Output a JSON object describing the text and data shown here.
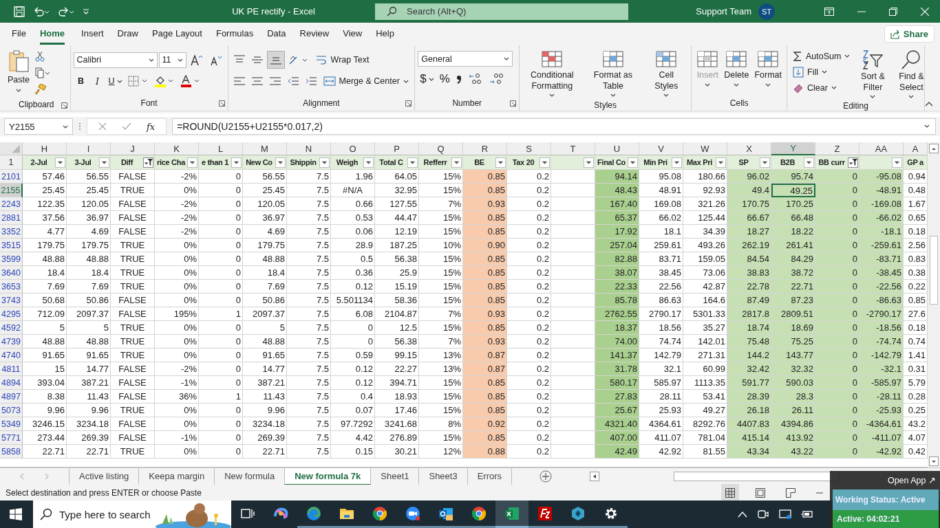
{
  "title_bar": {
    "title": "UK PE rectify  -  Excel",
    "search_placeholder": "Search (Alt+Q)",
    "user": "Support Team",
    "avatar": "ST"
  },
  "menu_tabs": [
    {
      "label": "File",
      "selected": false
    },
    {
      "label": "Home",
      "selected": true
    },
    {
      "label": "Insert",
      "selected": false
    },
    {
      "label": "Draw",
      "selected": false
    },
    {
      "label": "Page Layout",
      "selected": false
    },
    {
      "label": "Formulas",
      "selected": false
    },
    {
      "label": "Data",
      "selected": false
    },
    {
      "label": "Review",
      "selected": false
    },
    {
      "label": "View",
      "selected": false
    },
    {
      "label": "Help",
      "selected": false
    }
  ],
  "share": "Share",
  "ribbon": {
    "groups": [
      {
        "kind": "clipboard",
        "label": "Clipboard",
        "paste": "Paste"
      },
      {
        "kind": "font",
        "label": "Font",
        "font_name": "Calibri",
        "font_size": "11",
        "bold": "B",
        "italic": "I",
        "underline": "U"
      },
      {
        "kind": "alignment",
        "label": "Alignment",
        "wrap": "Wrap Text",
        "merge": "Merge & Center"
      },
      {
        "kind": "number",
        "label": "Number",
        "format": "General",
        "currency": "$",
        "percent": "%"
      },
      {
        "kind": "large",
        "label": "Styles",
        "buttons": [
          {
            "label": "Conditional Formatting",
            "disabled": false
          },
          {
            "label": "Format as Table",
            "disabled": false
          },
          {
            "label": "Cell Styles",
            "disabled": false
          }
        ]
      },
      {
        "kind": "large",
        "label": "Cells",
        "buttons": [
          {
            "label": "Insert",
            "disabled": true
          },
          {
            "label": "Delete",
            "disabled": false
          },
          {
            "label": "Format",
            "disabled": false
          }
        ]
      },
      {
        "kind": "editing",
        "label": "Editing",
        "small": [
          "AutoSum",
          "Fill",
          "Clear"
        ],
        "large": [
          "Sort & Filter",
          "Find & Select"
        ]
      }
    ]
  },
  "formula_bar": {
    "name_box": "Y2155",
    "fx": "fx",
    "formula": "=ROUND(U2155+U2155*0.017,2)"
  },
  "sheet": {
    "columns": [
      {
        "letter": "H",
        "header": "2-Jul",
        "filter_button": true,
        "filtered": false,
        "selected": false,
        "color": "#ffffff"
      },
      {
        "letter": "I",
        "header": "3-Jul",
        "filter_button": true,
        "filtered": false,
        "selected": false,
        "color": "#ffffff"
      },
      {
        "letter": "J",
        "header": "Diff",
        "filter_button": true,
        "filtered": true,
        "selected": false,
        "color": "#ffffff"
      },
      {
        "letter": "K",
        "header": "rice Cha",
        "filter_button": true,
        "filtered": false,
        "selected": false,
        "color": "#ffffff"
      },
      {
        "letter": "L",
        "header": "e than 1",
        "filter_button": true,
        "filtered": false,
        "selected": false,
        "color": "#ffffff"
      },
      {
        "letter": "M",
        "header": "New Co",
        "filter_button": true,
        "filtered": false,
        "selected": false,
        "color": "#ffffff"
      },
      {
        "letter": "N",
        "header": "Shippin",
        "filter_button": true,
        "filtered": false,
        "selected": false,
        "color": "#ffffff"
      },
      {
        "letter": "O",
        "header": "Weigh",
        "filter_button": true,
        "filtered": false,
        "selected": false,
        "color": "#ffffff"
      },
      {
        "letter": "P",
        "header": "Total C",
        "filter_button": true,
        "filtered": false,
        "selected": false,
        "color": "#ffffff"
      },
      {
        "letter": "Q",
        "header": "Refferr",
        "filter_button": true,
        "filtered": false,
        "selected": false,
        "color": "#ffffff"
      },
      {
        "letter": "R",
        "header": "BE",
        "filter_button": true,
        "filtered": false,
        "selected": false,
        "color": "#f8cbad"
      },
      {
        "letter": "S",
        "header": "Tax 20",
        "filter_button": true,
        "filtered": false,
        "selected": false,
        "color": "#ffffff"
      },
      {
        "letter": "T",
        "filter_button": true,
        "filtered": false,
        "selected": false,
        "color": "#ffffff"
      },
      {
        "letter": "U",
        "header": "Final Co",
        "filter_button": true,
        "filtered": false,
        "selected": false,
        "color": "#a9d08e"
      },
      {
        "letter": "V",
        "header": "Min Pri",
        "filter_button": true,
        "filtered": false,
        "selected": false,
        "color": "#ffffff"
      },
      {
        "letter": "W",
        "header": "Max Pri",
        "filter_button": true,
        "filtered": false,
        "selected": false,
        "color": "#ffffff"
      },
      {
        "letter": "X",
        "header": "SP",
        "filter_button": true,
        "filtered": false,
        "selected": false,
        "color": "#c6e0b4"
      },
      {
        "letter": "Y",
        "header": "B2B",
        "filter_button": true,
        "filtered": false,
        "selected": true,
        "color": "#c6e0b4"
      },
      {
        "letter": "Z",
        "header": "BB curr",
        "filter_button": true,
        "filtered": true,
        "selected": false,
        "color": "#c6e0b4"
      },
      {
        "letter": "AA",
        "filter_button": true,
        "filtered": false,
        "selected": false,
        "color": "#c6e0b4"
      },
      {
        "letter": "A",
        "header": "GP a",
        "filter_button": false,
        "selected": false,
        "color": "#ffffff"
      }
    ],
    "header_row": "1",
    "rows": [
      {
        "row": "2101",
        "selected": false,
        "cells": [
          "57.46",
          "56.55",
          "FALSE",
          "-2%",
          "0",
          "56.55",
          "7.5",
          "1.96",
          "64.05",
          "15%",
          "0.85",
          "0.2",
          null,
          "94.14",
          "95.08",
          "180.66",
          "96.02",
          "95.74",
          "0",
          "-95.08",
          "0.94"
        ]
      },
      {
        "row": "2155",
        "selected": true,
        "cells": [
          "25.45",
          "25.45",
          "TRUE",
          "0%",
          "0",
          "25.45",
          "7.5",
          "#N/A",
          "32.95",
          "15%",
          "0.85",
          "0.2",
          null,
          "48.43",
          "48.91",
          "92.93",
          "49.4",
          "49.25",
          "0",
          "-48.91",
          "0.48"
        ]
      },
      {
        "row": "2243",
        "selected": false,
        "cells": [
          "122.35",
          "120.05",
          "FALSE",
          "-2%",
          "0",
          "120.05",
          "7.5",
          "0.66",
          "127.55",
          "7%",
          "0.93",
          "0.2",
          null,
          "167.40",
          "169.08",
          "321.26",
          "170.75",
          "170.25",
          "0",
          "-169.08",
          "1.67"
        ]
      },
      {
        "row": "2881",
        "selected": false,
        "cells": [
          "37.56",
          "36.97",
          "FALSE",
          "-2%",
          "0",
          "36.97",
          "7.5",
          "0.53",
          "44.47",
          "15%",
          "0.85",
          "0.2",
          null,
          "65.37",
          "66.02",
          "125.44",
          "66.67",
          "66.48",
          "0",
          "-66.02",
          "0.65"
        ]
      },
      {
        "row": "3352",
        "selected": false,
        "cells": [
          "4.77",
          "4.69",
          "FALSE",
          "-2%",
          "0",
          "4.69",
          "7.5",
          "0.06",
          "12.19",
          "15%",
          "0.85",
          "0.2",
          null,
          "17.92",
          "18.1",
          "34.39",
          "18.27",
          "18.22",
          "0",
          "-18.1",
          "0.18"
        ]
      },
      {
        "row": "3515",
        "selected": false,
        "cells": [
          "179.75",
          "179.75",
          "TRUE",
          "0%",
          "0",
          "179.75",
          "7.5",
          "28.9",
          "187.25",
          "10%",
          "0.90",
          "0.2",
          null,
          "257.04",
          "259.61",
          "493.26",
          "262.19",
          "261.41",
          "0",
          "-259.61",
          "2.56"
        ]
      },
      {
        "row": "3599",
        "selected": false,
        "cells": [
          "48.88",
          "48.88",
          "TRUE",
          "0%",
          "0",
          "48.88",
          "7.5",
          "0.5",
          "56.38",
          "15%",
          "0.85",
          "0.2",
          null,
          "82.88",
          "83.71",
          "159.05",
          "84.54",
          "84.29",
          "0",
          "-83.71",
          "0.83"
        ]
      },
      {
        "row": "3640",
        "selected": false,
        "cells": [
          "18.4",
          "18.4",
          "TRUE",
          "0%",
          "0",
          "18.4",
          "7.5",
          "0.36",
          "25.9",
          "15%",
          "0.85",
          "0.2",
          null,
          "38.07",
          "38.45",
          "73.06",
          "38.83",
          "38.72",
          "0",
          "-38.45",
          "0.38"
        ]
      },
      {
        "row": "3653",
        "selected": false,
        "cells": [
          "7.69",
          "7.69",
          "TRUE",
          "0%",
          "0",
          "7.69",
          "7.5",
          "0.12",
          "15.19",
          "15%",
          "0.85",
          "0.2",
          null,
          "22.33",
          "22.56",
          "42.87",
          "22.78",
          "22.71",
          "0",
          "-22.56",
          "0.22"
        ]
      },
      {
        "row": "3743",
        "selected": false,
        "cells": [
          "50.68",
          "50.86",
          "FALSE",
          "0%",
          "0",
          "50.86",
          "7.5",
          "5.501134",
          "58.36",
          "15%",
          "0.85",
          "0.2",
          null,
          "85.78",
          "86.63",
          "164.6",
          "87.49",
          "87.23",
          "0",
          "-86.63",
          "0.85"
        ]
      },
      {
        "row": "4295",
        "selected": false,
        "cells": [
          "712.09",
          "2097.37",
          "FALSE",
          "195%",
          "1",
          "2097.37",
          "7.5",
          "6.08",
          "2104.87",
          "7%",
          "0.93",
          "0.2",
          null,
          "2762.55",
          "2790.17",
          "5301.33",
          "2817.8",
          "2809.51",
          "0",
          "-2790.17",
          "27.6"
        ]
      },
      {
        "row": "4592",
        "selected": false,
        "cells": [
          "5",
          "5",
          "TRUE",
          "0%",
          "0",
          "5",
          "7.5",
          "0",
          "12.5",
          "15%",
          "0.85",
          "0.2",
          null,
          "18.37",
          "18.56",
          "35.27",
          "18.74",
          "18.69",
          "0",
          "-18.56",
          "0.18"
        ]
      },
      {
        "row": "4739",
        "selected": false,
        "cells": [
          "48.88",
          "48.88",
          "TRUE",
          "0%",
          "0",
          "48.88",
          "7.5",
          "0",
          "56.38",
          "7%",
          "0.93",
          "0.2",
          null,
          "74.00",
          "74.74",
          "142.01",
          "75.48",
          "75.25",
          "0",
          "-74.74",
          "0.74"
        ]
      },
      {
        "row": "4740",
        "selected": false,
        "cells": [
          "91.65",
          "91.65",
          "TRUE",
          "0%",
          "0",
          "91.65",
          "7.5",
          "0.59",
          "99.15",
          "13%",
          "0.87",
          "0.2",
          null,
          "141.37",
          "142.79",
          "271.31",
          "144.2",
          "143.77",
          "0",
          "-142.79",
          "1.41"
        ]
      },
      {
        "row": "4811",
        "selected": false,
        "cells": [
          "15",
          "14.77",
          "FALSE",
          "-2%",
          "0",
          "14.77",
          "7.5",
          "0.12",
          "22.27",
          "13%",
          "0.87",
          "0.2",
          null,
          "31.78",
          "32.1",
          "60.99",
          "32.42",
          "32.32",
          "0",
          "-32.1",
          "0.31"
        ]
      },
      {
        "row": "4894",
        "selected": false,
        "cells": [
          "393.04",
          "387.21",
          "FALSE",
          "-1%",
          "0",
          "387.21",
          "7.5",
          "0.12",
          "394.71",
          "15%",
          "0.85",
          "0.2",
          null,
          "580.17",
          "585.97",
          "1113.35",
          "591.77",
          "590.03",
          "0",
          "-585.97",
          "5.79"
        ]
      },
      {
        "row": "4897",
        "selected": false,
        "cells": [
          "8.38",
          "11.43",
          "FALSE",
          "36%",
          "1",
          "11.43",
          "7.5",
          "0.4",
          "18.93",
          "15%",
          "0.85",
          "0.2",
          null,
          "27.83",
          "28.11",
          "53.41",
          "28.39",
          "28.3",
          "0",
          "-28.11",
          "0.28"
        ]
      },
      {
        "row": "5073",
        "selected": false,
        "cells": [
          "9.96",
          "9.96",
          "TRUE",
          "0%",
          "0",
          "9.96",
          "7.5",
          "0.07",
          "17.46",
          "15%",
          "0.85",
          "0.2",
          null,
          "25.67",
          "25.93",
          "49.27",
          "26.18",
          "26.11",
          "0",
          "-25.93",
          "0.25"
        ]
      },
      {
        "row": "5349",
        "selected": false,
        "cells": [
          "3246.15",
          "3234.18",
          "FALSE",
          "0%",
          "0",
          "3234.18",
          "7.5",
          "97.7292",
          "3241.68",
          "8%",
          "0.92",
          "0.2",
          null,
          "4321.40",
          "4364.61",
          "8292.76",
          "4407.83",
          "4394.86",
          "0",
          "-4364.61",
          "43.2"
        ]
      },
      {
        "row": "5771",
        "selected": false,
        "cells": [
          "273.44",
          "269.39",
          "FALSE",
          "-1%",
          "0",
          "269.39",
          "7.5",
          "4.42",
          "276.89",
          "15%",
          "0.85",
          "0.2",
          null,
          "407.00",
          "411.07",
          "781.04",
          "415.14",
          "413.92",
          "0",
          "-411.07",
          "4.07"
        ]
      },
      {
        "row": "5858",
        "selected": false,
        "cells": [
          "22.71",
          "22.71",
          "TRUE",
          "0%",
          "0",
          "22.71",
          "7.5",
          "0.15",
          "30.21",
          "12%",
          "0.88",
          "0.2",
          null,
          "42.49",
          "42.92",
          "81.55",
          "43.34",
          "43.22",
          "0",
          "-42.92",
          "0.42"
        ]
      }
    ]
  },
  "sheet_tabs": [
    {
      "label": "Active listing",
      "selected": false
    },
    {
      "label": "Keepa margin",
      "selected": false
    },
    {
      "label": "New formula",
      "selected": false
    },
    {
      "label": "New formula 7k",
      "selected": true
    },
    {
      "label": "Sheet1",
      "selected": false
    },
    {
      "label": "Sheet3",
      "selected": false
    },
    {
      "label": "Errors",
      "selected": false
    }
  ],
  "status_bar": {
    "message": "Select destination and press ENTER or choose Paste"
  },
  "overlay": {
    "open_app": "Open App ↗",
    "working_status": "Working Status: Active",
    "active_time": "Active: 04:02:21"
  },
  "taskbar": {
    "search_placeholder": "Type here to search",
    "apps": [
      {
        "kind": "taskview",
        "active": false,
        "running": false
      },
      {
        "kind": "swirl",
        "active": false,
        "running": false
      },
      {
        "kind": "browser",
        "active": false,
        "running": true
      },
      {
        "kind": "folder",
        "active": false,
        "running": true
      },
      {
        "kind": "chrome",
        "active": false,
        "running": true
      },
      {
        "kind": "video",
        "active": false,
        "running": true
      },
      {
        "kind": "mail",
        "active": false,
        "running": true
      },
      {
        "kind": "chrome",
        "active": false,
        "running": true
      },
      {
        "kind": "sheet",
        "active": true,
        "running": true
      },
      {
        "kind": "ftp",
        "active": false,
        "running": true
      },
      {
        "kind": "hex",
        "active": false,
        "running": true
      },
      {
        "kind": "gear",
        "active": false,
        "running": true
      }
    ]
  }
}
